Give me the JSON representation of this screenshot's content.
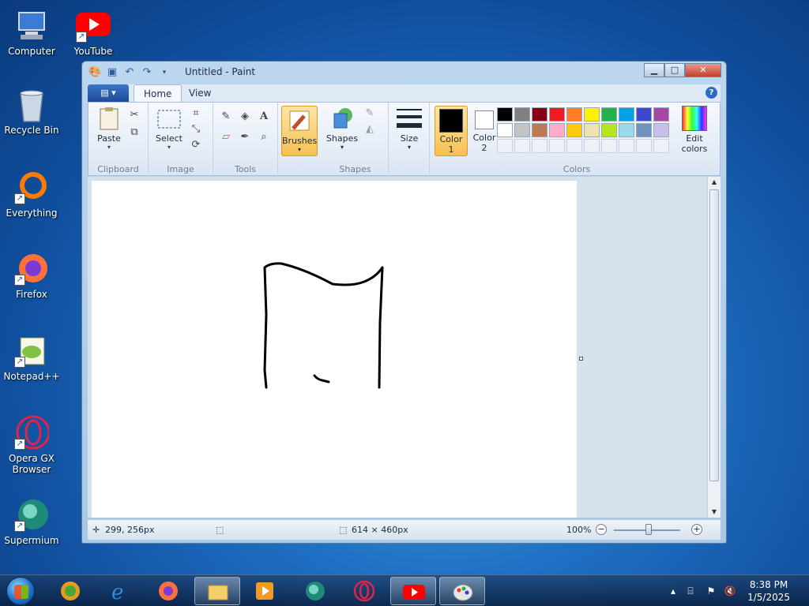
{
  "desktop": {
    "icons": [
      {
        "label": "Computer"
      },
      {
        "label": "YouTube"
      },
      {
        "label": "Recycle Bin"
      },
      {
        "label": "Everything"
      },
      {
        "label": "Firefox"
      },
      {
        "label": "Notepad++"
      },
      {
        "label": "Opera GX Browser"
      },
      {
        "label": "Supermium"
      }
    ]
  },
  "window": {
    "title": "Untitled - Paint",
    "tabs": [
      "Home",
      "View"
    ],
    "ribbon": {
      "clipboard": {
        "label": "Clipboard",
        "paste": "Paste"
      },
      "image": {
        "label": "Image",
        "select": "Select"
      },
      "tools": {
        "label": "Tools"
      },
      "brushes": "Brushes",
      "shapes": {
        "label": "Shapes",
        "button": "Shapes"
      },
      "size": "Size",
      "color1": "Color\n1",
      "color1_line1": "Color",
      "color1_line2": "1",
      "color2_line1": "Color",
      "color2_line2": "2",
      "edit_colors_line1": "Edit",
      "edit_colors_line2": "colors",
      "colors_label": "Colors",
      "palette_row1": [
        "#000000",
        "#7f7f7f",
        "#880015",
        "#ed1c24",
        "#ff7f27",
        "#fff200",
        "#22b14c",
        "#00a2e8",
        "#3f48cc",
        "#a349a4"
      ],
      "palette_row2": [
        "#ffffff",
        "#c3c3c3",
        "#b97a57",
        "#ffaec9",
        "#ffc90e",
        "#efe4b0",
        "#b5e61d",
        "#99d9ea",
        "#7092be",
        "#c8bfe7"
      ],
      "active_color1": "#000000",
      "active_color2": "#ffffff"
    },
    "status": {
      "cursor_pos": "299, 256px",
      "canvas_size": "614 × 460px",
      "zoom": "100%"
    }
  },
  "taskbar": {
    "time": "8:38 PM",
    "date": "1/5/2025"
  }
}
